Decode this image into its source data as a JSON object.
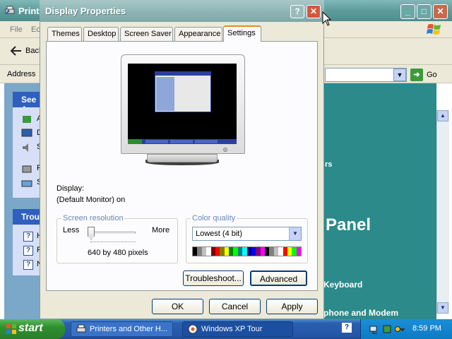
{
  "background_window": {
    "title": "Printers and Other Hardware",
    "title_visible": "Printe",
    "menu": [
      "File",
      "Ec"
    ],
    "back_label": "Back",
    "address_label": "Address",
    "go_label": "Go",
    "see_also_label": "See A",
    "troubleshooters_label": "Trou",
    "see_also_letters": [
      "A",
      "D",
      "S",
      "P",
      "S"
    ],
    "trouble_letters": [
      "H",
      "P",
      "N"
    ],
    "peek_text_1": "rs",
    "peek_heading": "Panel",
    "peek_link_1": "Keyboard",
    "peek_link_2": "phone and Modem"
  },
  "dialog": {
    "title": "Display Properties",
    "help_glyph": "?",
    "close_glyph": "✕",
    "tabs": [
      {
        "label": "Themes",
        "active": false
      },
      {
        "label": "Desktop",
        "active": false
      },
      {
        "label": "Screen Saver",
        "active": false
      },
      {
        "label": "Appearance",
        "active": false
      },
      {
        "label": "Settings",
        "active": true
      }
    ],
    "display_label": "Display:",
    "display_value": "(Default Monitor) on",
    "resolution": {
      "legend": "Screen resolution",
      "less": "Less",
      "more": "More",
      "value": "640 by 480 pixels",
      "slider_position": 0
    },
    "color_quality": {
      "legend": "Color quality",
      "selected": "Lowest (4 bit)",
      "palette": [
        "#000000",
        "#808080",
        "#c0c0c0",
        "#ffffff",
        "#800000",
        "#ff0000",
        "#808000",
        "#ffff00",
        "#008000",
        "#00ff00",
        "#008080",
        "#00ffff",
        "#000080",
        "#0000ff",
        "#800080",
        "#ff00ff",
        "#000000",
        "#808080",
        "#c0c0c0",
        "#ffffff",
        "#ff0000",
        "#ffff00",
        "#00ff00",
        "#ff00ff"
      ]
    },
    "buttons": {
      "troubleshoot": "Troubleshoot...",
      "advanced": "Advanced",
      "ok": "OK",
      "cancel": "Cancel",
      "apply": "Apply"
    }
  },
  "taskbar": {
    "start_label": "start",
    "tasks": [
      "Printers and Other H...",
      "Windows XP Tour"
    ],
    "clock": "8:59 PM"
  },
  "colors": {
    "accent_tab": "#e68b2c",
    "taskbar": "#2456a8",
    "start": "#2f8f2f",
    "close": "#d5573a"
  }
}
